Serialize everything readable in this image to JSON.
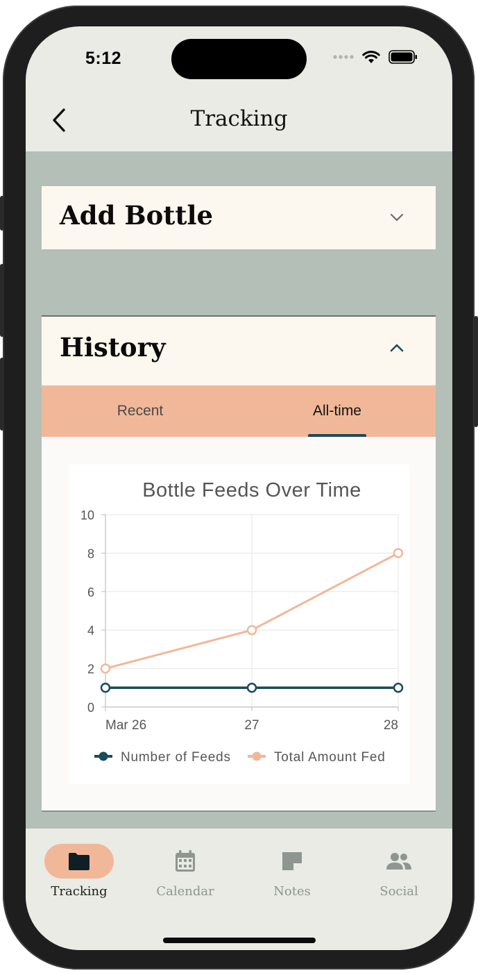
{
  "status_bar": {
    "time": "5:12"
  },
  "header": {
    "title": "Tracking"
  },
  "add_bottle": {
    "title": "Add Bottle",
    "expanded": false
  },
  "history": {
    "title": "History",
    "expanded": true,
    "tabs": [
      {
        "label": "Recent",
        "active": false
      },
      {
        "label": "All-time",
        "active": true
      }
    ]
  },
  "chart_data": {
    "type": "line",
    "title": "Bottle Feeds Over Time",
    "x": [
      "Mar 26",
      "27",
      "28"
    ],
    "ylim": [
      0,
      10
    ],
    "yticks": [
      0,
      2,
      4,
      6,
      8,
      10
    ],
    "grid": true,
    "legend_position": "bottom",
    "series": [
      {
        "name": "Number of Feeds",
        "values": [
          1,
          1,
          1
        ],
        "color": "#1b4a5c"
      },
      {
        "name": "Total Amount Fed",
        "values": [
          2,
          4,
          8
        ],
        "color": "#f0b899"
      }
    ]
  },
  "tab_bar": {
    "items": [
      {
        "label": "Tracking",
        "icon": "folder-icon",
        "active": true
      },
      {
        "label": "Calendar",
        "icon": "calendar-icon",
        "active": false
      },
      {
        "label": "Notes",
        "icon": "note-icon",
        "active": false
      },
      {
        "label": "Social",
        "icon": "people-icon",
        "active": false
      }
    ]
  },
  "colors": {
    "accent": "#f0b899",
    "navy": "#1b4a5c",
    "content_bg": "#b3bfb7",
    "card_bg": "#fcf7ef",
    "inactive": "#8f9590"
  }
}
